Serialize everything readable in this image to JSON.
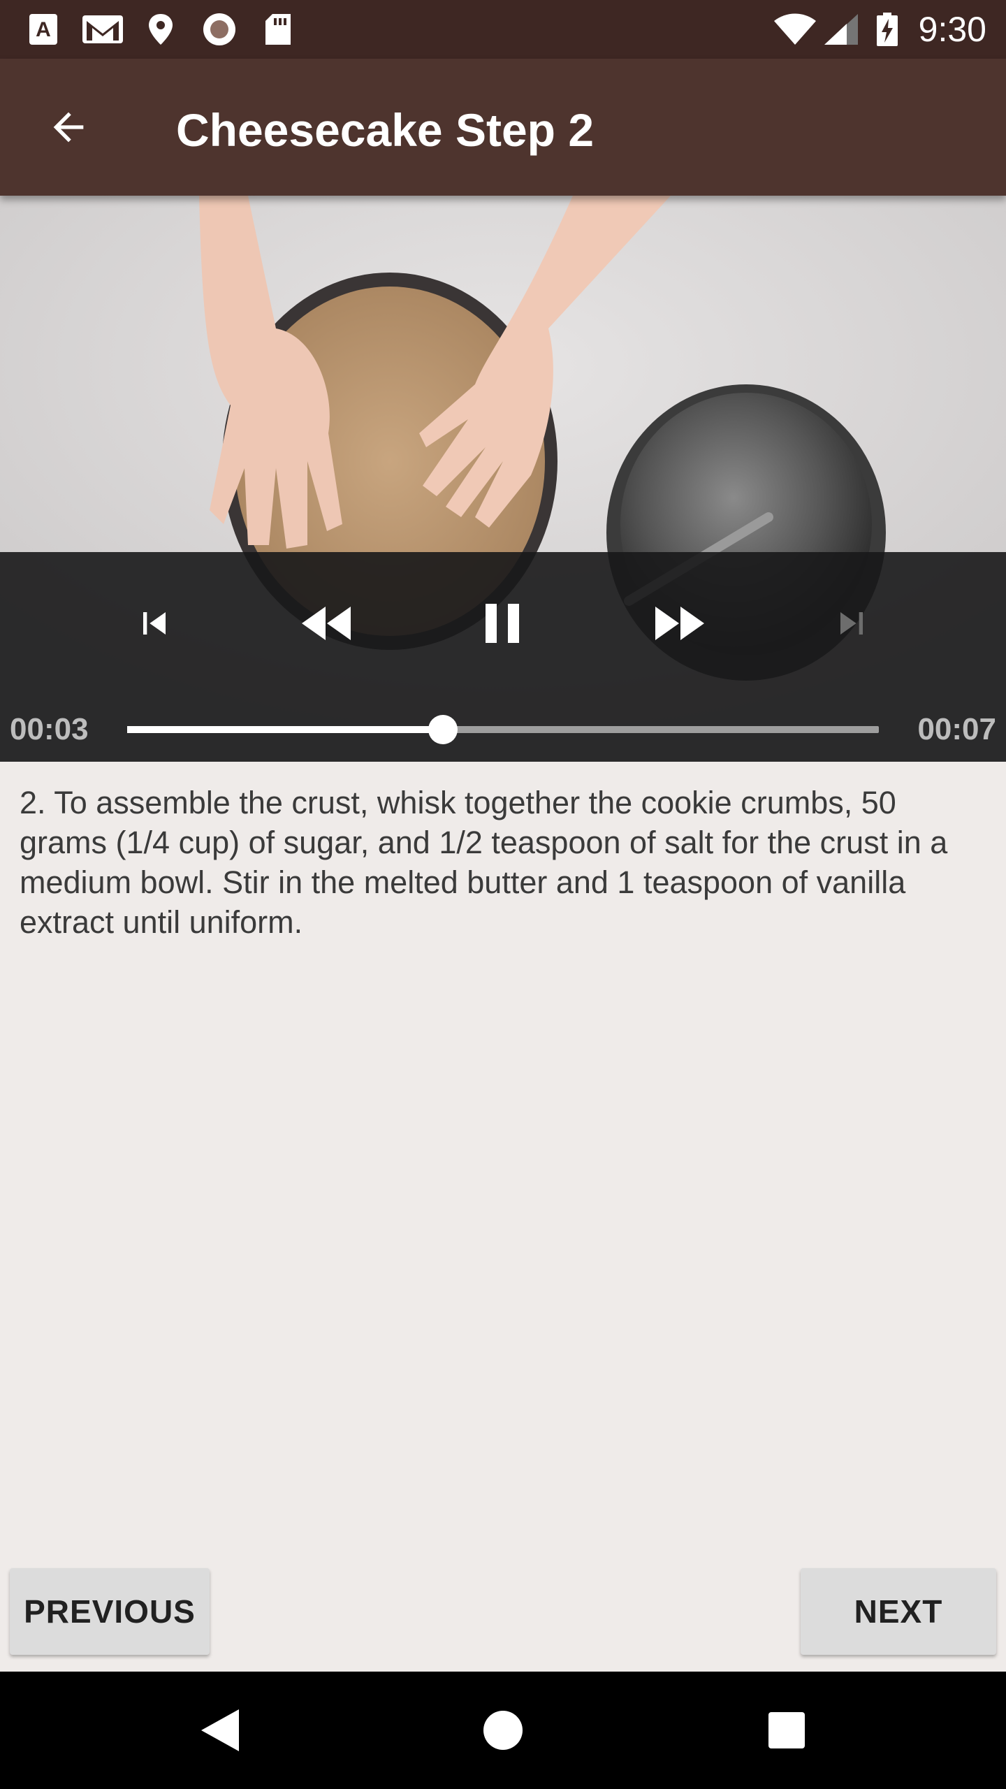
{
  "status_bar": {
    "time": "9:30",
    "left_icons": [
      "text-notification-icon",
      "gmail-icon",
      "location-pin-icon",
      "record-icon",
      "sd-card-icon"
    ],
    "right_icons": [
      "wifi-icon",
      "cell-signal-icon",
      "battery-charging-icon"
    ]
  },
  "app_bar": {
    "title": "Cheesecake Step 2",
    "back_icon": "arrow-back-icon"
  },
  "player": {
    "position": "00:03",
    "duration": "00:07",
    "progress": 0.42,
    "controls": [
      "skip-previous-icon",
      "rewind-icon",
      "pause-icon",
      "fast-forward-icon",
      "skip-next-icon"
    ]
  },
  "step": {
    "description": "2. To assemble the crust, whisk together the cookie crumbs, 50 grams (1/4 cup) of sugar, and 1/2 teaspoon of salt for the crust in a medium bowl. Stir in the melted butter and 1 teaspoon of vanilla extract until uniform."
  },
  "buttons": {
    "previous": "PREVIOUS",
    "next": "NEXT"
  },
  "colors": {
    "status_bar": "#3e2723",
    "app_bar": "#4e342e",
    "background": "#efebe9",
    "button": "#dcdcdc"
  }
}
